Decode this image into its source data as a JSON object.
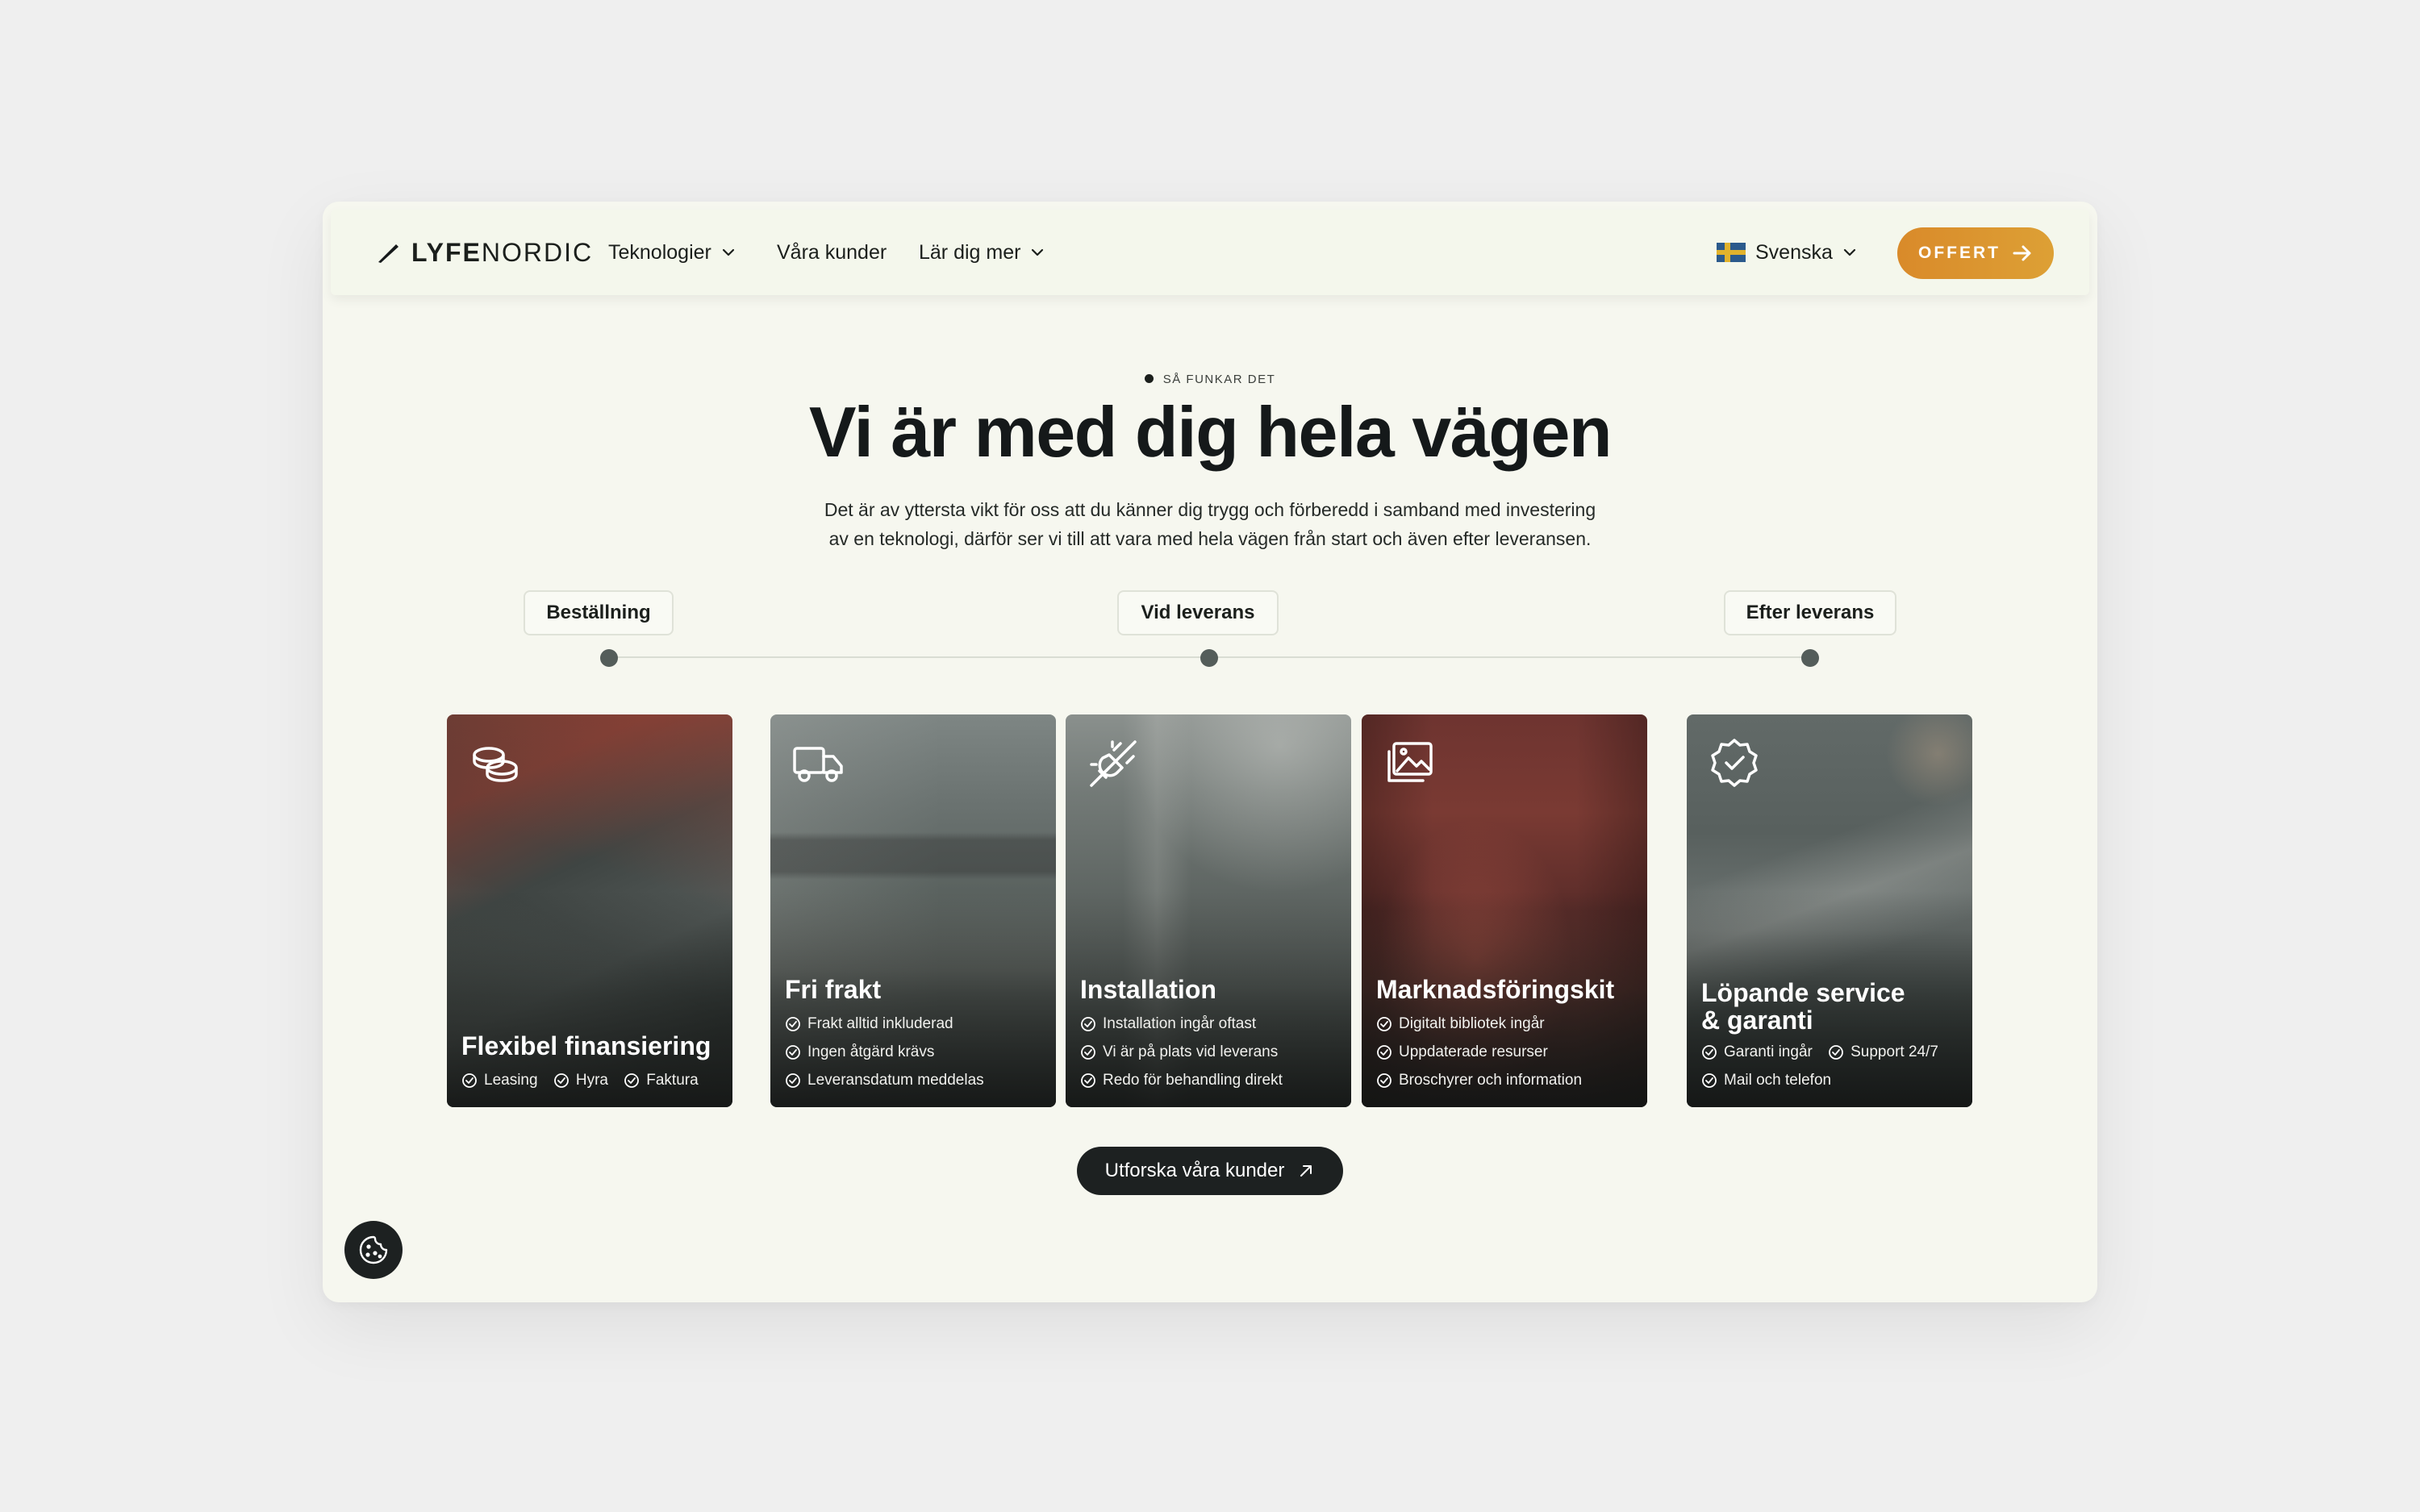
{
  "nav": {
    "logo_strong": "LYFE",
    "logo_light": "NORDIC",
    "items": [
      {
        "label": "Teknologier",
        "dropdown": true
      },
      {
        "label": "Våra kunder",
        "dropdown": false
      },
      {
        "label": "Lär dig mer",
        "dropdown": true
      }
    ],
    "language": "Svenska",
    "offert_label": "OFFERT"
  },
  "hero": {
    "eyebrow": "SÅ FUNKAR DET",
    "headline": "Vi är med dig hela vägen",
    "lede_line1": "Det är av yttersta vikt för oss att du känner dig trygg och förberedd i samband med investering",
    "lede_line2": "av en teknologi, därför ser vi till att vara med hela vägen från start och även efter leveransen."
  },
  "timeline": {
    "steps": [
      "Beställning",
      "Vid leverans",
      "Efter leverans"
    ]
  },
  "cards": [
    {
      "icon": "coins-icon",
      "title": "Flexibel finansiering",
      "features": [
        "Leasing",
        "Hyra",
        "Faktura"
      ]
    },
    {
      "icon": "truck-icon",
      "title": "Fri frakt",
      "features": [
        "Frakt alltid inkluderad",
        "Ingen åtgärd krävs",
        "Leveransdatum meddelas"
      ]
    },
    {
      "icon": "plug-icon",
      "title": "Installation",
      "features": [
        "Installation ingår oftast",
        "Vi är på plats vid leverans",
        "Redo för behandling direkt"
      ]
    },
    {
      "icon": "images-icon",
      "title": "Marknadsföringskit",
      "features": [
        "Digitalt bibliotek ingår",
        "Uppdaterade resurser",
        "Broschyrer och information"
      ]
    },
    {
      "icon": "badge-check-icon",
      "title_line1": "Löpande service",
      "title_line2": "& garanti",
      "features": [
        "Garanti ingår",
        "Support 24/7",
        "Mail och telefon"
      ]
    }
  ],
  "cta_label": "Utforska våra kunder",
  "colors": {
    "accent": "#d98a2a",
    "dark": "#1d2121",
    "page_bg": "#f6f7ef"
  }
}
